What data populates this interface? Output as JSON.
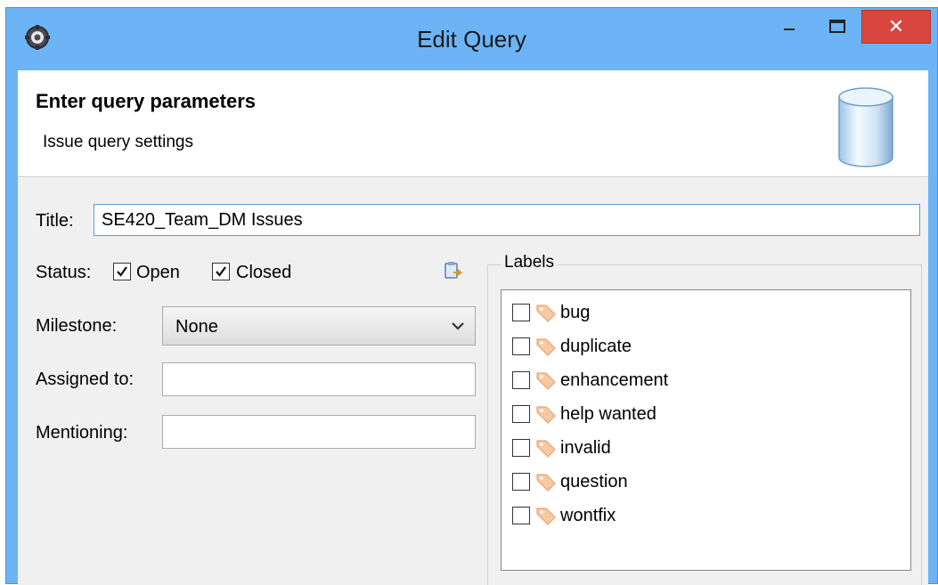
{
  "window": {
    "title": "Edit Query",
    "close_glyph": "✕"
  },
  "header": {
    "title": "Enter query parameters",
    "subtitle": "Issue query settings"
  },
  "form": {
    "title_label": "Title:",
    "title_value": "SE420_Team_DM Issues",
    "status_label": "Status:",
    "status_open_label": "Open",
    "status_open_checked": true,
    "status_closed_label": "Closed",
    "status_closed_checked": true,
    "milestone_label": "Milestone:",
    "milestone_value": "None",
    "assigned_label": "Assigned to:",
    "assigned_value": "",
    "mentioning_label": "Mentioning:",
    "mentioning_value": ""
  },
  "labels_group": {
    "legend": "Labels",
    "items": [
      {
        "label": "bug",
        "checked": false
      },
      {
        "label": "duplicate",
        "checked": false
      },
      {
        "label": "enhancement",
        "checked": false
      },
      {
        "label": "help wanted",
        "checked": false
      },
      {
        "label": "invalid",
        "checked": false
      },
      {
        "label": "question",
        "checked": false
      },
      {
        "label": "wontfix",
        "checked": false
      }
    ]
  },
  "icons": {
    "app": "eclipse-gear-icon",
    "minimize": "minimize-icon",
    "maximize": "maximize-icon",
    "close": "close-icon",
    "header": "database-cylinder-icon",
    "paste": "paste-clipboard-icon",
    "dropdown": "chevron-down-icon",
    "label": "tag-icon"
  },
  "colors": {
    "titlebar": "#6cb4f5",
    "close_button": "#d9463f",
    "focus_border": "#5b9bd5"
  }
}
